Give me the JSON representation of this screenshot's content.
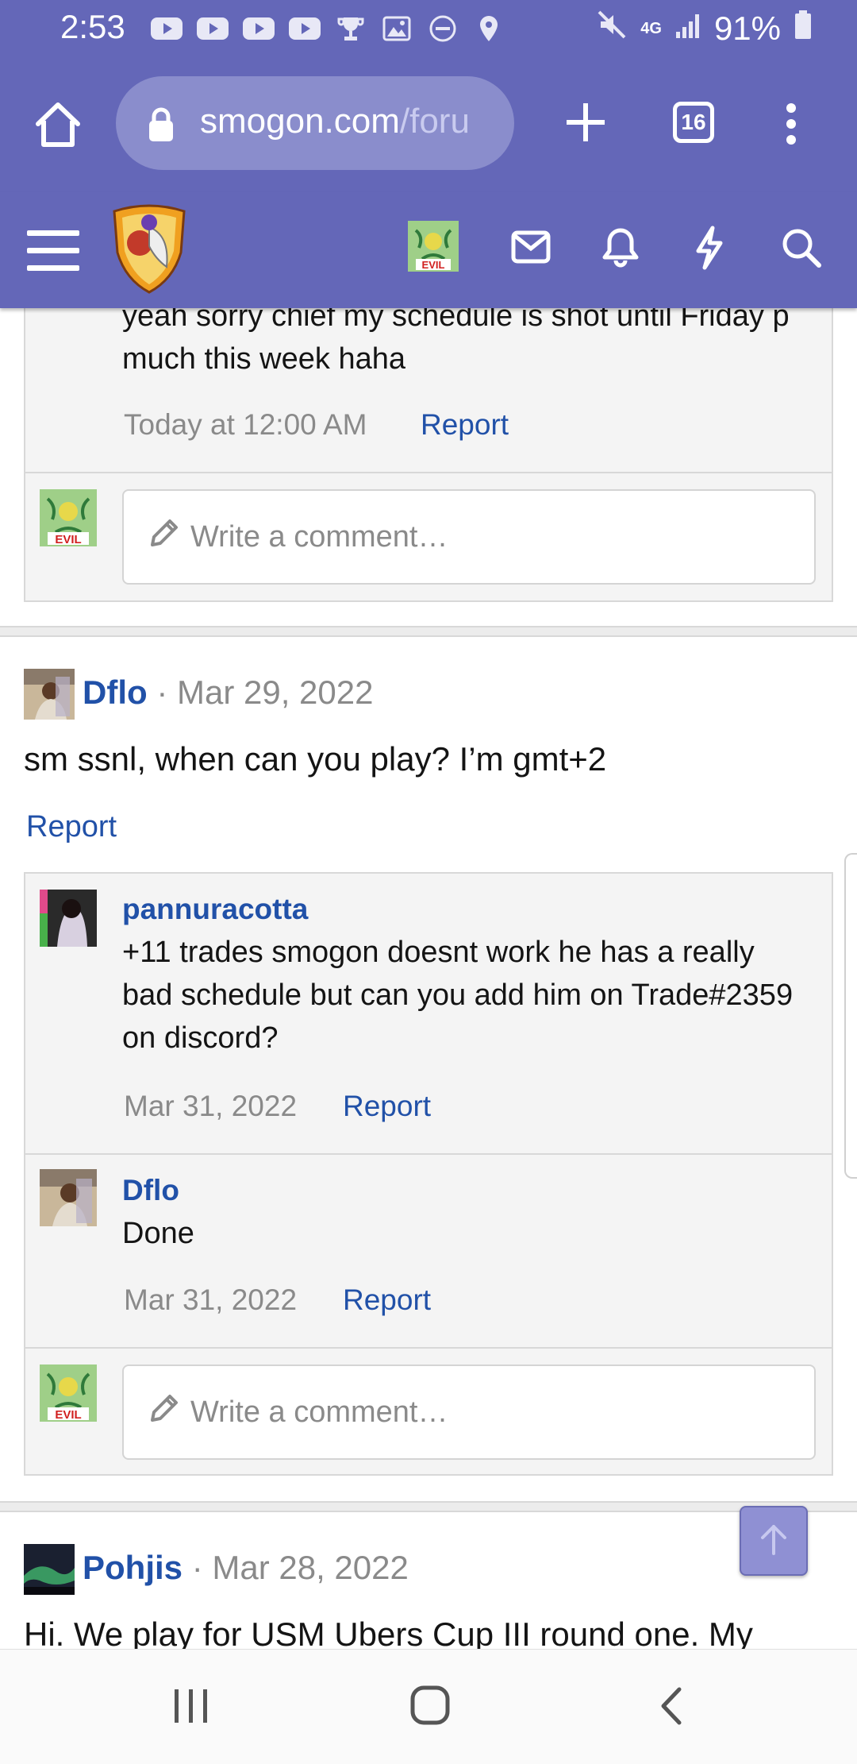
{
  "status_bar": {
    "time": "2:53",
    "battery": "91%",
    "network": "4G",
    "icons": [
      "youtube-icon",
      "youtube-icon",
      "youtube-icon",
      "youtube-icon",
      "trophy-icon",
      "gallery-icon",
      "dnd-icon",
      "location-icon"
    ]
  },
  "browser": {
    "url_host": "smogon.com",
    "url_rest": "/foru",
    "tab_count": "16"
  },
  "site_header": {
    "avatar_text": "EVIL"
  },
  "thread1": {
    "text_line1": "yeah sorry chief my schedule is shot until Friday p",
    "text_line2": "much this week haha",
    "time": "Today at 12:00 AM",
    "report": "Report",
    "comment_placeholder": "Write a comment…"
  },
  "post_dflo": {
    "author": "Dflo",
    "sep": " · ",
    "date": "Mar 29, 2022",
    "body": "sm ssnl, when can you play? I’m gmt+2",
    "report": "Report",
    "replies": [
      {
        "author": "pannuracotta",
        "line1": "+11 trades smogon doesnt work he has a really",
        "line2": "bad schedule but can you add him on Trade#2359",
        "line3": "on discord?",
        "date": "Mar 31, 2022",
        "report": "Report"
      },
      {
        "author": "Dflo",
        "line1": "Done",
        "date": "Mar 31, 2022",
        "report": "Report"
      }
    ],
    "comment_placeholder": "Write a comment…"
  },
  "post_pohjis": {
    "author": "Pohjis",
    "sep": " · ",
    "date": "Mar 28, 2022",
    "body": "Hi. We play for USM Ubers Cup III round one. My"
  },
  "colors": {
    "brand": "#6467b8",
    "link": "#2151a8",
    "muted": "#8a8a8a"
  }
}
